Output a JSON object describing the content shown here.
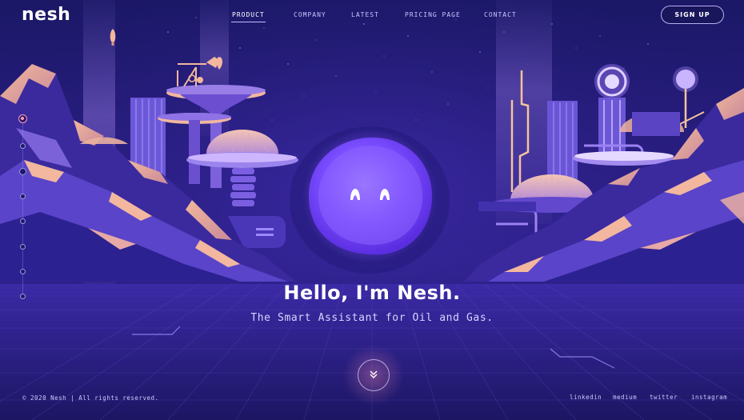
{
  "brand": {
    "logo_text": "nesh"
  },
  "nav": {
    "items": [
      {
        "label": "PRODUCT",
        "active": true
      },
      {
        "label": "COMPANY",
        "active": false
      },
      {
        "label": "LATEST",
        "active": false
      },
      {
        "label": "PRICING PAGE",
        "active": false
      },
      {
        "label": "CONTACT",
        "active": false
      }
    ],
    "signup_label": "SIGN UP"
  },
  "hero": {
    "title": "Hello, I'm Nesh.",
    "subtitle": "The Smart Assistant for Oil and Gas."
  },
  "slides": {
    "count": 8,
    "active_index": 0
  },
  "footer": {
    "copyright": "© 2020 Nesh | All rights reserved.",
    "social": [
      "linkedin",
      "medium",
      "twitter",
      "instagram"
    ]
  },
  "icons": {
    "scroll": "double-chevron-down-icon",
    "mascot": "nesh-mascot-icon"
  },
  "colors": {
    "background": "#231b7a",
    "accent_pink": "#ff9db6",
    "accent_peach": "#f4b59a",
    "mascot_purple": "#8b5cff",
    "text_muted": "#cfc9ff"
  }
}
